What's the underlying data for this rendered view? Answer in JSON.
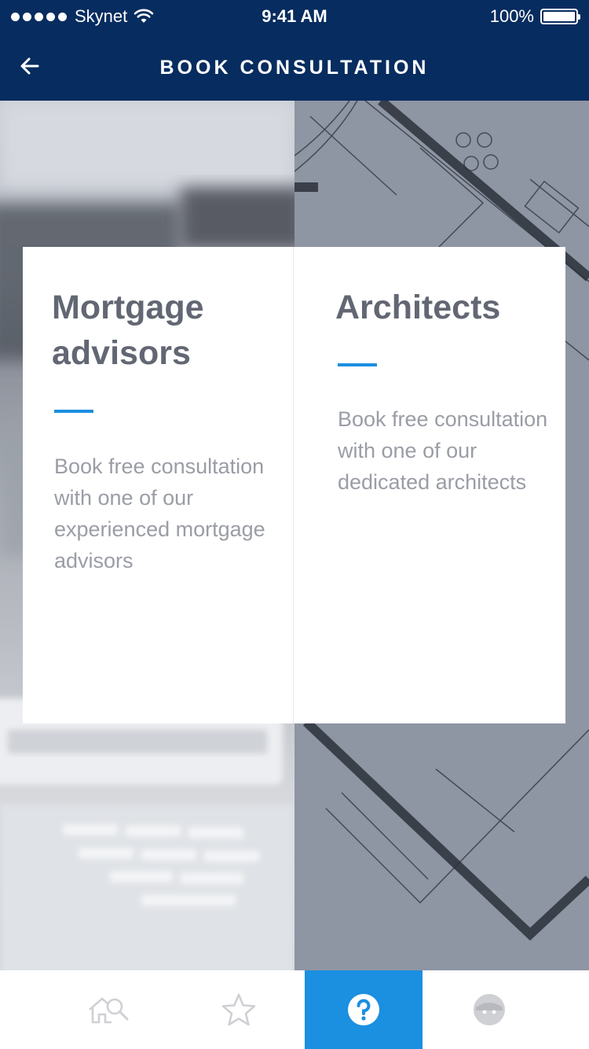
{
  "status_bar": {
    "carrier": "Skynet",
    "time": "9:41 AM",
    "battery": "100%"
  },
  "header": {
    "title": "BOOK CONSULTATION",
    "back_icon": "arrow-left-icon"
  },
  "cards": [
    {
      "title": "Mortgage advisors",
      "description": "Book free consultation with one of our experienced mortgage advisors"
    },
    {
      "title": "Architects",
      "description": "Book free consultation with one of our dedicated architects"
    }
  ],
  "tabs": [
    {
      "icon": "house-search-icon",
      "active": false
    },
    {
      "icon": "star-icon",
      "active": false
    },
    {
      "icon": "question-icon",
      "active": true
    },
    {
      "icon": "profile-icon",
      "active": false
    }
  ],
  "colors": {
    "header_bg": "#072c5f",
    "accent": "#1b8fe0",
    "title_text": "#626773",
    "body_text": "#9a9da5"
  }
}
